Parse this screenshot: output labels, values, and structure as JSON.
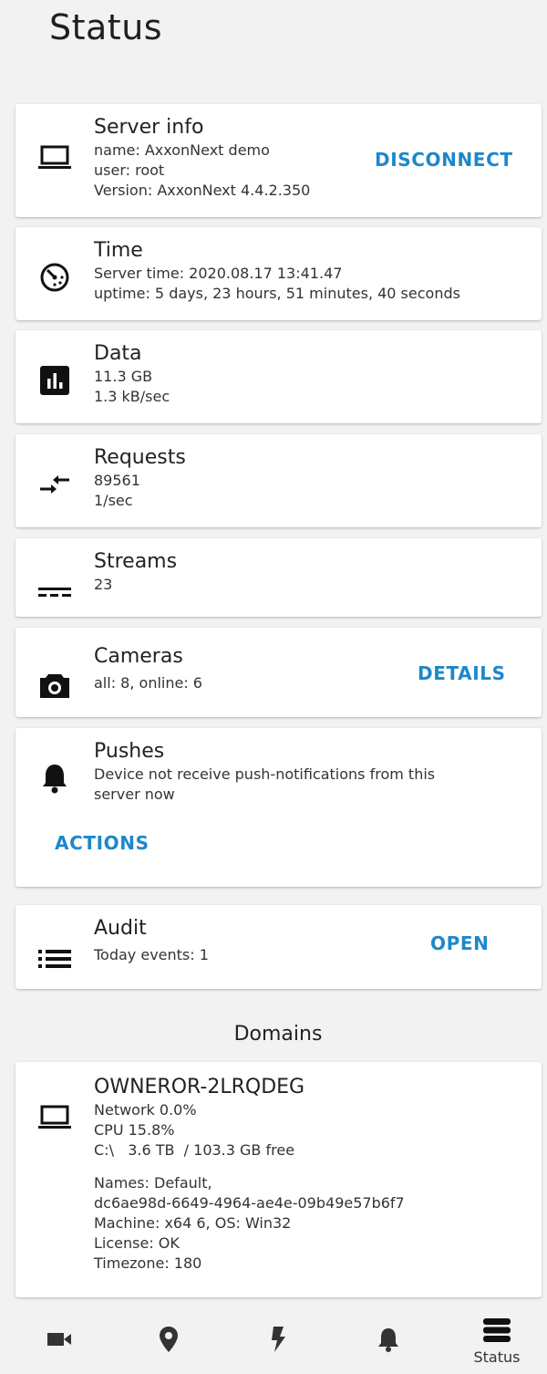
{
  "header": {
    "title": "Status"
  },
  "server_info": {
    "title": "Server info",
    "name": "name: AxxonNext demo",
    "user": "user: root",
    "version": "Version: AxxonNext 4.4.2.350",
    "action": "DISCONNECT",
    "icon": "laptop-icon"
  },
  "time": {
    "title": "Time",
    "server_time": "Server time: 2020.08.17 13:41.47",
    "uptime": "uptime: 5 days, 23 hours, 51 minutes, 40 seconds",
    "icon": "timer-icon"
  },
  "data": {
    "title": "Data",
    "size": "11.3 GB",
    "rate": "1.3 kB/sec",
    "icon": "bar-chart-icon"
  },
  "requests": {
    "title": "Requests",
    "count": "89561",
    "rate": "1/sec",
    "icon": "compare-arrows-icon"
  },
  "streams": {
    "title": "Streams",
    "count": "23",
    "icon": "streams-icon"
  },
  "cameras": {
    "title": "Cameras",
    "summary": "all: 8, online: 6",
    "action": "DETAILS",
    "icon": "camera-icon"
  },
  "pushes": {
    "title": "Pushes",
    "message_line1": "Device not receive push-notifications from this",
    "message_line2": "server now",
    "action": "ACTIONS",
    "icon": "bell-icon"
  },
  "audit": {
    "title": "Audit",
    "events": "Today events: 1",
    "action": "OPEN",
    "icon": "list-icon"
  },
  "domains": {
    "section_title": "Domains",
    "items": [
      {
        "name": "OWNEROR-2LRQDEG",
        "network": "Network 0.0%",
        "cpu": "CPU 15.8%",
        "disk": "C:\\   3.6 TB  / 103.3 GB free",
        "names_label": "Names: Default,",
        "names_id": "dc6ae98d-6649-4964-ae4e-09b49e57b6f7",
        "machine": "Machine: x64 6, OS: Win32",
        "license": "License: OK",
        "timezone": "Timezone: 180",
        "icon": "laptop-icon"
      }
    ]
  },
  "bottom_nav": {
    "items": [
      {
        "icon": "video-camera-icon",
        "label": ""
      },
      {
        "icon": "map-pin-icon",
        "label": ""
      },
      {
        "icon": "lightning-icon",
        "label": ""
      },
      {
        "icon": "bell-icon",
        "label": ""
      },
      {
        "icon": "server-stack-icon",
        "label": "Status"
      }
    ]
  },
  "colors": {
    "accent": "#1d88c9",
    "background": "#f2f2f2",
    "card": "#ffffff"
  }
}
